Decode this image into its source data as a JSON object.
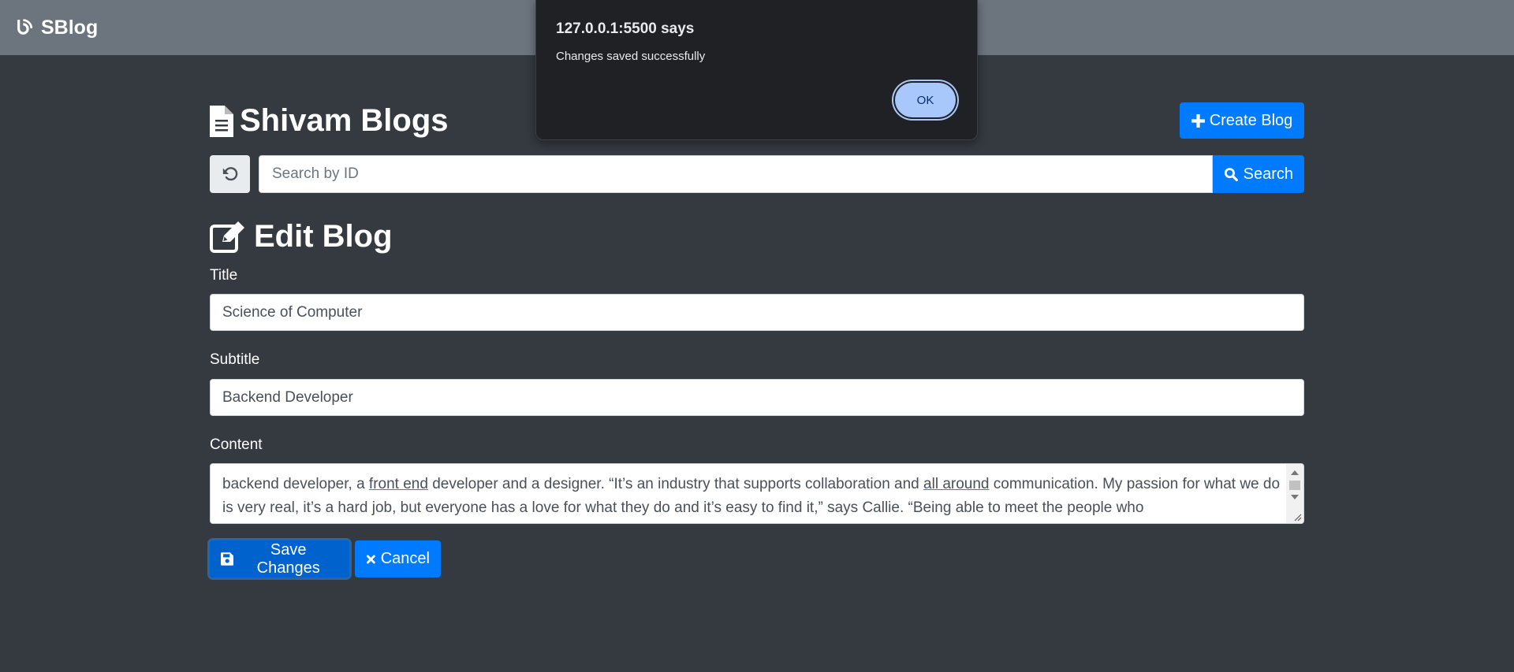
{
  "navbar": {
    "brand": "SBlog",
    "brand_icon": "blogger-icon"
  },
  "header": {
    "title": "Shivam Blogs",
    "title_icon": "document-icon",
    "create_label": "Create Blog"
  },
  "search": {
    "placeholder": "Search by ID",
    "value": "",
    "button_label": "Search"
  },
  "editor": {
    "heading": "Edit Blog",
    "title_label": "Title",
    "title_value": "Science of Computer",
    "subtitle_label": "Subtitle",
    "subtitle_value": "Backend Developer",
    "content_label": "Content",
    "content_parts": [
      "backend developer, a ",
      "front end",
      " developer and a designer. “It’s an industry that supports collaboration and ",
      "all around",
      " communication. My passion for what we do is very real, it’s a hard job, but everyone has a love for what they do and it’s easy to find it,” says Callie. “Being able to meet the people who"
    ],
    "save_label": "Save Changes",
    "cancel_label": "Cancel"
  },
  "dialog": {
    "title": "127.0.0.1:5500 says",
    "message": "Changes saved successfully",
    "ok_label": "OK"
  },
  "colors": {
    "background": "#343a40",
    "navbar": "#6c757d",
    "primary": "#007bff",
    "dialog_bg": "#202124",
    "dialog_button": "#a8c7fa"
  }
}
